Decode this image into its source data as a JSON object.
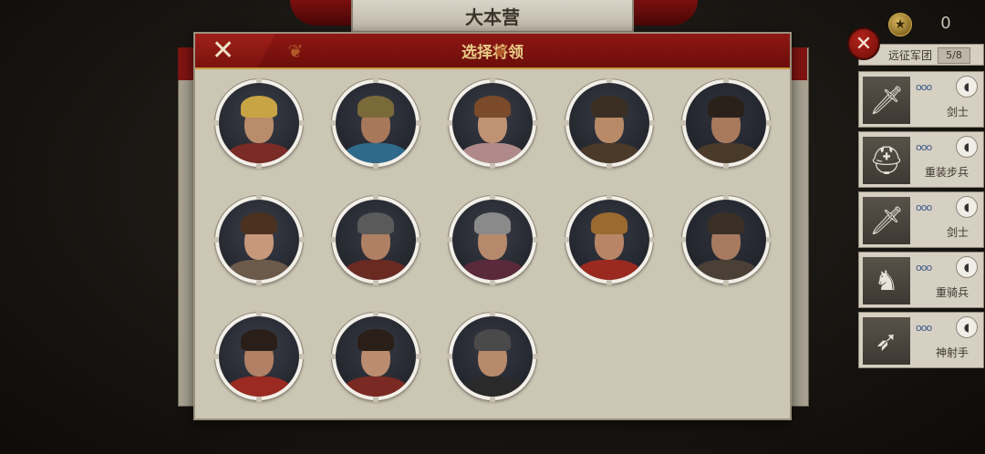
{
  "top_banner": {
    "title": "大本营"
  },
  "currency": {
    "value": "0",
    "icon": "medal-icon"
  },
  "dialog": {
    "title": "选择将领",
    "close_icon": "close-icon",
    "generals": [
      {
        "name": "general-1",
        "skin": "#b98c6b",
        "bg": "#3b3f4a",
        "body": "#7a2b26",
        "helm": "#c9a445"
      },
      {
        "name": "general-2",
        "skin": "#a8785a",
        "bg": "#353944",
        "body": "#2f6a8a",
        "helm": "#7a6a3a"
      },
      {
        "name": "general-3",
        "skin": "#c09274",
        "bg": "#3a3d48",
        "body": "#b08a8a",
        "helm": "#7a4a2a"
      },
      {
        "name": "general-4",
        "skin": "#b88a68",
        "bg": "#373a44",
        "body": "#4b3a2a",
        "helm": "#3a2f22"
      },
      {
        "name": "general-5",
        "skin": "#a9795d",
        "bg": "#2f333d",
        "body": "#4a3a2a",
        "helm": "#2a211a"
      },
      {
        "name": "general-6",
        "skin": "#c7987a",
        "bg": "#3b3f4a",
        "body": "#6b5a4a",
        "helm": "#4a3120"
      },
      {
        "name": "general-7",
        "skin": "#b08064",
        "bg": "#373a44",
        "body": "#6a2a22",
        "helm": "#5a5a5a"
      },
      {
        "name": "general-8",
        "skin": "#b7896c",
        "bg": "#3a3d48",
        "body": "#5a2a3a",
        "helm": "#8a8a8a"
      },
      {
        "name": "general-9",
        "skin": "#b88566",
        "bg": "#353944",
        "body": "#9a2a20",
        "helm": "#9a6a30"
      },
      {
        "name": "general-10",
        "skin": "#a87a60",
        "bg": "#2f333d",
        "body": "#4a4036",
        "helm": "#3a3026"
      },
      {
        "name": "general-11",
        "skin": "#b28064",
        "bg": "#3b3f4a",
        "body": "#9a2a22",
        "helm": "#2a1f18"
      },
      {
        "name": "general-12",
        "skin": "#bb8c6e",
        "bg": "#373a44",
        "body": "#7a2a22",
        "helm": "#2a1f18"
      },
      {
        "name": "general-13",
        "skin": "#b78a6c",
        "bg": "#353944",
        "body": "#2a2a2a",
        "helm": "#4a4a4a"
      }
    ]
  },
  "army": {
    "title": "远征军团",
    "count": "5/8",
    "units": [
      {
        "name": "剑士",
        "icon": "sword-icon",
        "glyph": "🗡"
      },
      {
        "name": "重装步兵",
        "icon": "helmet-icon",
        "glyph": "⛑"
      },
      {
        "name": "剑士",
        "icon": "sword-icon",
        "glyph": "🗡"
      },
      {
        "name": "重骑兵",
        "icon": "horse-icon",
        "glyph": "♞"
      },
      {
        "name": "神射手",
        "icon": "crossbow-icon",
        "glyph": "➶"
      }
    ]
  }
}
